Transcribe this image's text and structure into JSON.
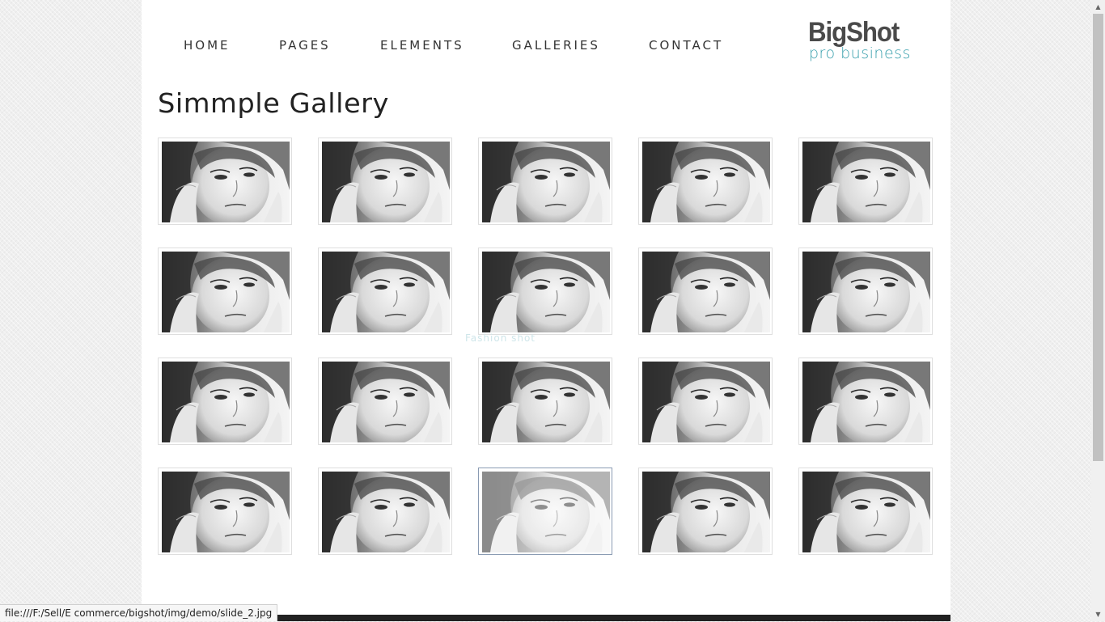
{
  "nav": {
    "items": [
      "HOME",
      "PAGES",
      "ELEMENTS",
      "GALLERIES",
      "CONTACT"
    ]
  },
  "logo": {
    "brand": "BigShot",
    "tagline": "pro business"
  },
  "page": {
    "title": "Simmple Gallery"
  },
  "gallery": {
    "count": 20,
    "columns": 5,
    "hovered_index": 17,
    "image_description": "black-and-white portrait of a woman",
    "hover_caption": "Fashion shot"
  },
  "status_bar": {
    "url": "file:///F:/Sell/E commerce/bigshot/img/demo/slide_2.jpg"
  },
  "colors": {
    "accent": "#3aa0ad",
    "text": "#333333",
    "logo": "#4a4a4a",
    "background": "#ffffff",
    "footer": "#222222"
  }
}
